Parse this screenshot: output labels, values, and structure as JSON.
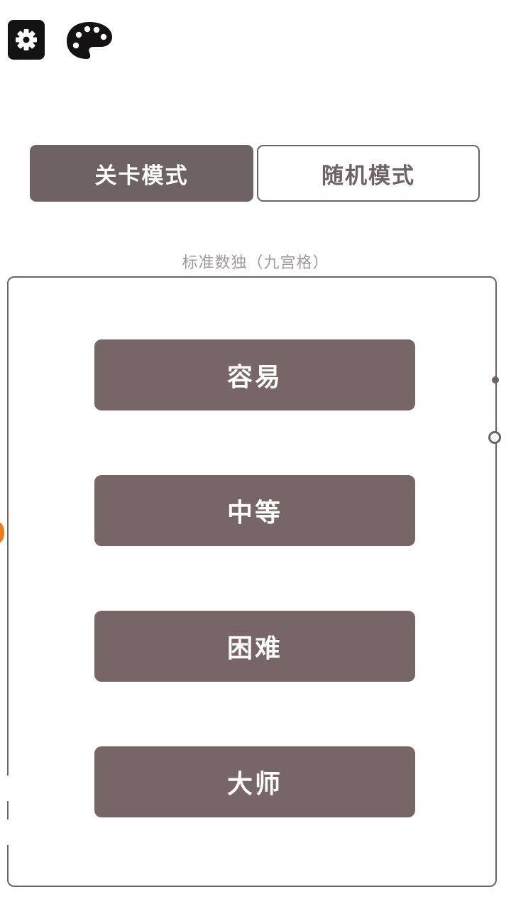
{
  "toolbar": {
    "settings_icon": "gear-icon",
    "palette_icon": "palette-icon"
  },
  "mode_tabs": [
    {
      "label": "关卡模式",
      "selected": true
    },
    {
      "label": "随机模式",
      "selected": false
    }
  ],
  "section_caption": "标准数独（九宫格）",
  "difficulties": [
    {
      "label": "容易"
    },
    {
      "label": "中等"
    },
    {
      "label": "困难"
    },
    {
      "label": "大师"
    }
  ],
  "colors": {
    "primary": "#6e6263",
    "button": "#786667",
    "caption": "#a19899",
    "accent_marker": "#f07a1a",
    "background": "#ffffff"
  }
}
